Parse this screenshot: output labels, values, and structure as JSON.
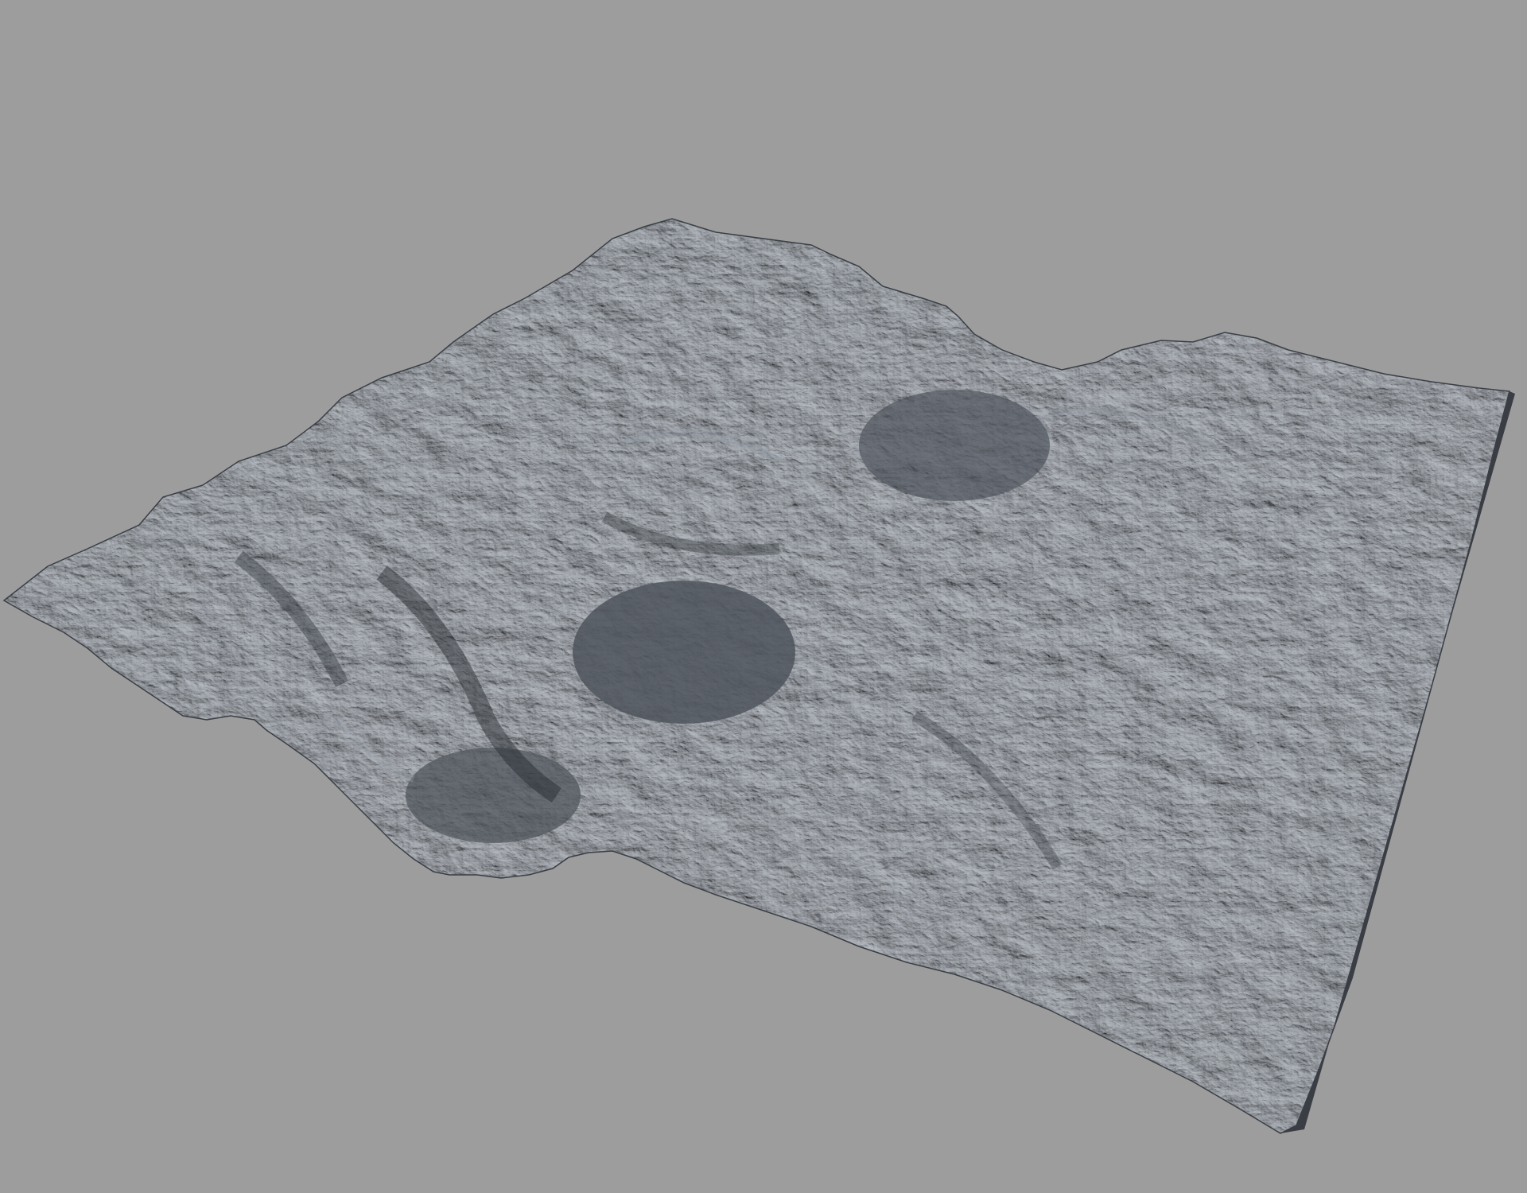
{
  "scene": {
    "subject": "terrain-heightmap-render",
    "background_color": "#9d9d9d",
    "terrain_base_color": "#4a4f56",
    "terrain_shadow_color": "#2a2e33",
    "terrain_highlight_color": "#8c949d",
    "terrain_mid_color": "#5a6068"
  }
}
